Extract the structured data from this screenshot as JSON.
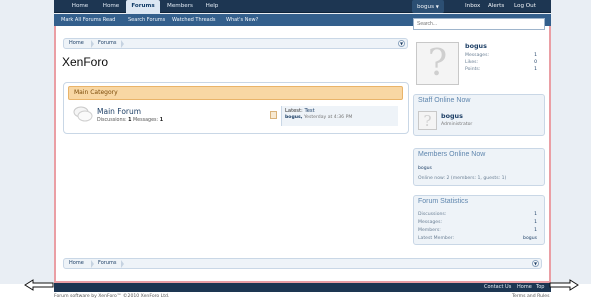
{
  "nav": {
    "tabs": [
      {
        "label": "Home"
      },
      {
        "label": "Home"
      },
      {
        "label": "Forums"
      },
      {
        "label": "Members"
      },
      {
        "label": "Help"
      }
    ],
    "user": "bogus",
    "inbox": "Inbox",
    "alerts": "Alerts",
    "logout": "Log Out"
  },
  "subnav": {
    "links": [
      "Mark All Forums Read",
      "Search Forums",
      "Watched Threads",
      "What's New?"
    ]
  },
  "search": {
    "placeholder": "Search..."
  },
  "breadcrumb": {
    "home": "Home",
    "forums": "Forums"
  },
  "page": {
    "title": "XenForo"
  },
  "category": {
    "title": "Main Category"
  },
  "forum": {
    "title": "Main Forum",
    "discussions_label": "Discussions:",
    "discussions": "1",
    "messages_label": "Messages:",
    "messages": "1",
    "latest_label": "Latest:",
    "latest_title": "Test",
    "latest_user": "bogus,",
    "latest_time": "Yesterday at 4:36 PM"
  },
  "sidebar": {
    "profile": {
      "username": "bogus",
      "messages_label": "Messages:",
      "messages": "1",
      "likes_label": "Likes:",
      "likes": "0",
      "points_label": "Points:",
      "points": "1"
    },
    "staff": {
      "title": "Staff Online Now",
      "username": "bogus",
      "role": "Administrator"
    },
    "members": {
      "title": "Members Online Now",
      "username": "bogus",
      "summary": "Online now: 2 (members: 1, guests: 1)"
    },
    "stats": {
      "title": "Forum Statistics",
      "discussions_label": "Discussions:",
      "discussions": "1",
      "messages_label": "Messages:",
      "messages": "1",
      "members_label": "Members:",
      "members": "1",
      "latest_label": "Latest Member:",
      "latest": "bogus"
    }
  },
  "footer": {
    "contact": "Contact Us",
    "home": "Home",
    "top": "Top",
    "copyright": "Forum software by XenForo™ ©2010 XenForo Ltd.",
    "terms": "Terms and Rules"
  },
  "colors": {
    "navbar": "#1d3652",
    "subnav": "#335f8c",
    "category_header": "#f8d7a4",
    "page_border": "#ea9ea4",
    "sidebar_head": "#5f86ae"
  }
}
